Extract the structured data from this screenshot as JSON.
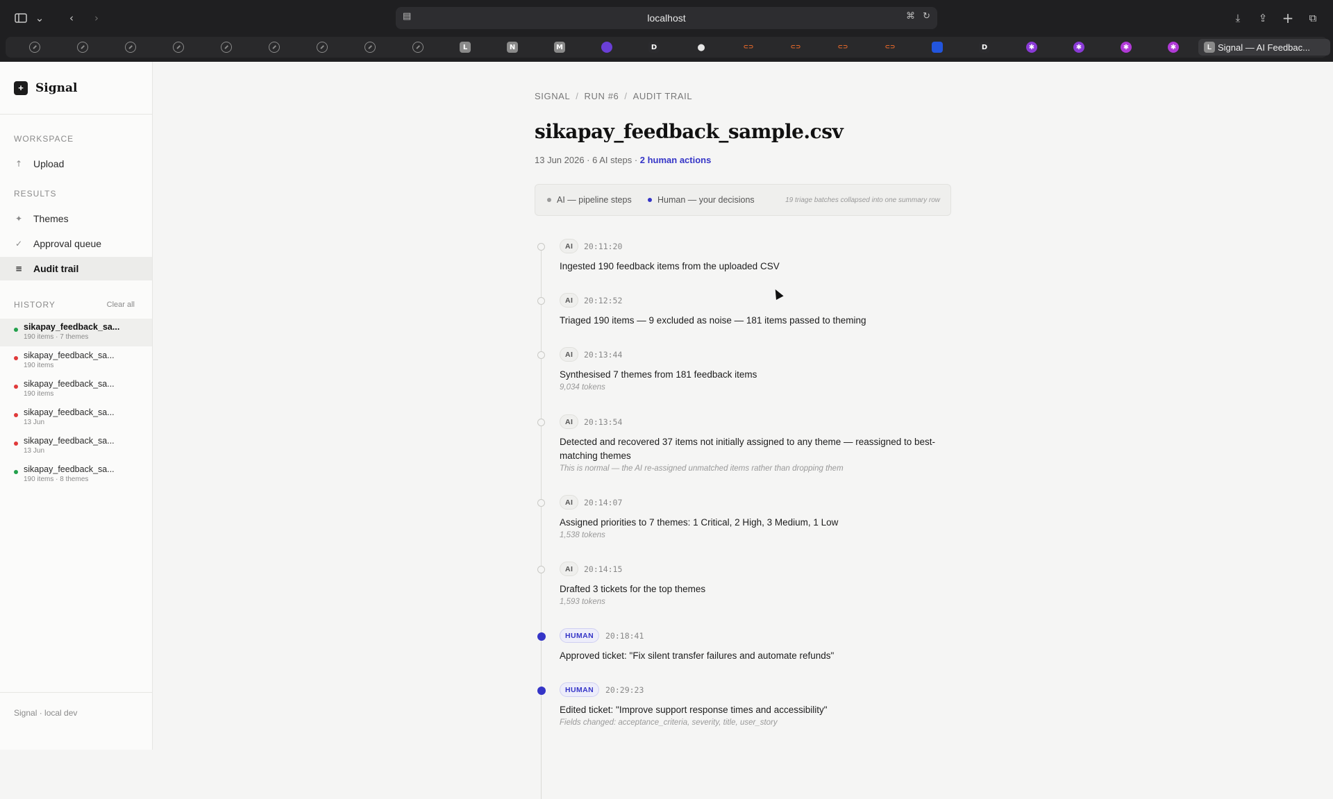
{
  "browser": {
    "url": "localhost",
    "active_tab_label": "Signal — AI Feedbac...",
    "active_tab_favicon": "L",
    "favorites": [
      {
        "icon": "compass-icon"
      },
      {
        "icon": "compass-icon"
      },
      {
        "icon": "compass-icon"
      },
      {
        "icon": "compass-icon"
      },
      {
        "icon": "compass-icon"
      },
      {
        "icon": "compass-icon"
      },
      {
        "icon": "compass-icon"
      },
      {
        "icon": "compass-icon"
      },
      {
        "icon": "compass-icon"
      },
      {
        "letter": "L",
        "color": "#8a8a8a"
      },
      {
        "letter": "N",
        "color": "#8a8a8a"
      },
      {
        "letter": "M",
        "color": "#8a8a8a"
      },
      {
        "icon": "orb-icon",
        "color": "#6a3fd6"
      },
      {
        "letter": "D",
        "color": "#2b2b2e"
      },
      {
        "icon": "github-icon",
        "color": "#e6e6e6"
      },
      {
        "icon": "bracket-icon",
        "color": "#e0662a"
      },
      {
        "icon": "bracket-icon",
        "color": "#e0662a"
      },
      {
        "icon": "bracket-icon",
        "color": "#e0662a"
      },
      {
        "icon": "bracket-icon",
        "color": "#e0662a"
      },
      {
        "icon": "flag-icon",
        "color": "#2255dd"
      },
      {
        "letter": "D",
        "color": "#2b2b2e"
      },
      {
        "icon": "asterisk-icon",
        "color": "#8a3ad6"
      },
      {
        "icon": "asterisk-icon",
        "color": "#8a3ad6"
      },
      {
        "icon": "asterisk-icon",
        "color": "#b03ad6"
      },
      {
        "icon": "asterisk-icon",
        "color": "#b03ad6"
      }
    ]
  },
  "brand": {
    "logo": "+",
    "name": "Signal"
  },
  "sidebar": {
    "workspace_heading": "WORKSPACE",
    "upload": "Upload",
    "results_heading": "RESULTS",
    "themes": "Themes",
    "approval": "Approval queue",
    "audit": "Audit trail",
    "history_heading": "HISTORY",
    "clear_all": "Clear all",
    "history": [
      {
        "title": "sikapay_feedback_sa...",
        "sub": "190 items · 7 themes",
        "status": "#22a04b"
      },
      {
        "title": "sikapay_feedback_sa...",
        "sub": "190 items",
        "status": "#e03a3a"
      },
      {
        "title": "sikapay_feedback_sa...",
        "sub": "190 items",
        "status": "#e03a3a"
      },
      {
        "title": "sikapay_feedback_sa...",
        "sub": "13 Jun",
        "status": "#e03a3a"
      },
      {
        "title": "sikapay_feedback_sa...",
        "sub": "13 Jun",
        "status": "#e03a3a"
      },
      {
        "title": "sikapay_feedback_sa...",
        "sub": "190 items · 8 themes",
        "status": "#22a04b"
      }
    ],
    "footer": "Signal · local dev"
  },
  "main": {
    "breadcrumb": [
      "SIGNAL",
      "RUN #6",
      "AUDIT TRAIL"
    ],
    "breadcrumb_sep": "/",
    "title": "sikapay_feedback_sample.csv",
    "meta_prefix": "13 Jun 2026 · 6 AI steps · ",
    "meta_human": "2 human actions",
    "legend": {
      "ai": "AI — pipeline steps",
      "human": "Human — your decisions",
      "note": "19 triage batches collapsed into one summary row"
    },
    "events": [
      {
        "actor": "AI",
        "time": "20:11:20",
        "text": "Ingested 190 feedback items from the uploaded CSV",
        "sub": ""
      },
      {
        "actor": "AI",
        "time": "20:12:52",
        "text": "Triaged 190 items — 9 excluded as noise — 181 items passed to theming",
        "sub": ""
      },
      {
        "actor": "AI",
        "time": "20:13:44",
        "text": "Synthesised 7 themes from 181 feedback items",
        "sub": "9,034 tokens"
      },
      {
        "actor": "AI",
        "time": "20:13:54",
        "text": "Detected and recovered 37 items not initially assigned to any theme — reassigned to best-matching themes",
        "sub": "This is normal — the AI re-assigned unmatched items rather than dropping them"
      },
      {
        "actor": "AI",
        "time": "20:14:07",
        "text": "Assigned priorities to 7 themes: 1 Critical, 2 High, 3 Medium, 1 Low",
        "sub": "1,538 tokens"
      },
      {
        "actor": "AI",
        "time": "20:14:15",
        "text": "Drafted 3 tickets for the top themes",
        "sub": "1,593 tokens"
      },
      {
        "actor": "HUMAN",
        "time": "20:18:41",
        "text": "Approved ticket: \"Fix silent transfer failures and automate refunds\"",
        "sub": ""
      },
      {
        "actor": "HUMAN",
        "time": "20:29:23",
        "text": "Edited ticket: \"Improve support response times and accessibility\"",
        "sub": "Fields changed: acceptance_criteria, severity, title, user_story"
      }
    ]
  },
  "colors": {
    "human": "#3535c7",
    "ai_dot": "#9a9a9a"
  }
}
